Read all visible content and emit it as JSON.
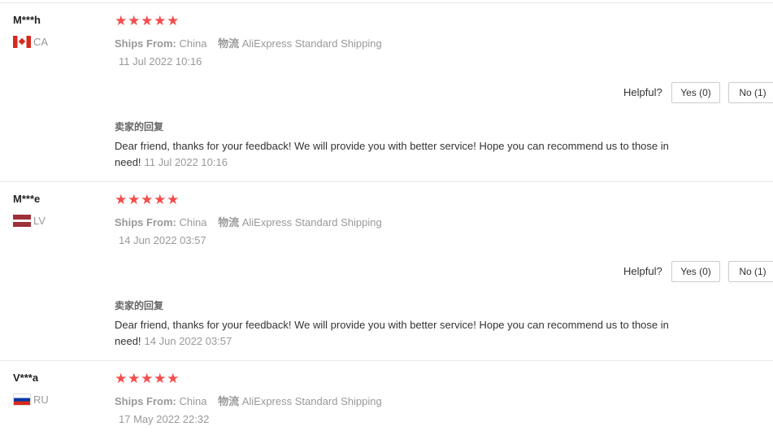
{
  "reviews": [
    {
      "user": "M***h",
      "country": "CA",
      "flag": "canada-flag-icon",
      "rating": 5,
      "ships_from_label": "Ships From:",
      "ships_from": "China",
      "logistics_label": "物流",
      "logistics": "AliExpress Standard Shipping",
      "date": "11 Jul 2022 10:16",
      "helpful_label": "Helpful?",
      "yes": "Yes (0)",
      "no": "No (1)",
      "seller_title": "卖家的回复",
      "seller_reply": "Dear friend, thanks for your feedback! We will provide you with better service! Hope you can recommend us to those in need!",
      "seller_date": "11 Jul 2022 10:16"
    },
    {
      "user": "M***e",
      "country": "LV",
      "flag": "latvia-flag-icon",
      "rating": 5,
      "ships_from_label": "Ships From:",
      "ships_from": "China",
      "logistics_label": "物流",
      "logistics": "AliExpress Standard Shipping",
      "date": "14 Jun 2022 03:57",
      "helpful_label": "Helpful?",
      "yes": "Yes (0)",
      "no": "No (1)",
      "seller_title": "卖家的回复",
      "seller_reply": "Dear friend, thanks for your feedback! We will provide you with better service! Hope you can recommend us to those in need!",
      "seller_date": "14 Jun 2022 03:57"
    },
    {
      "user": "V***a",
      "country": "RU",
      "flag": "russia-flag-icon",
      "rating": 5,
      "ships_from_label": "Ships From:",
      "ships_from": "China",
      "logistics_label": "物流",
      "logistics": "AliExpress Standard Shipping",
      "date": "17 May 2022 22:32"
    }
  ],
  "colors": {
    "star": "#f44d4d",
    "muted": "#999999",
    "border": "#e8e8e8"
  }
}
